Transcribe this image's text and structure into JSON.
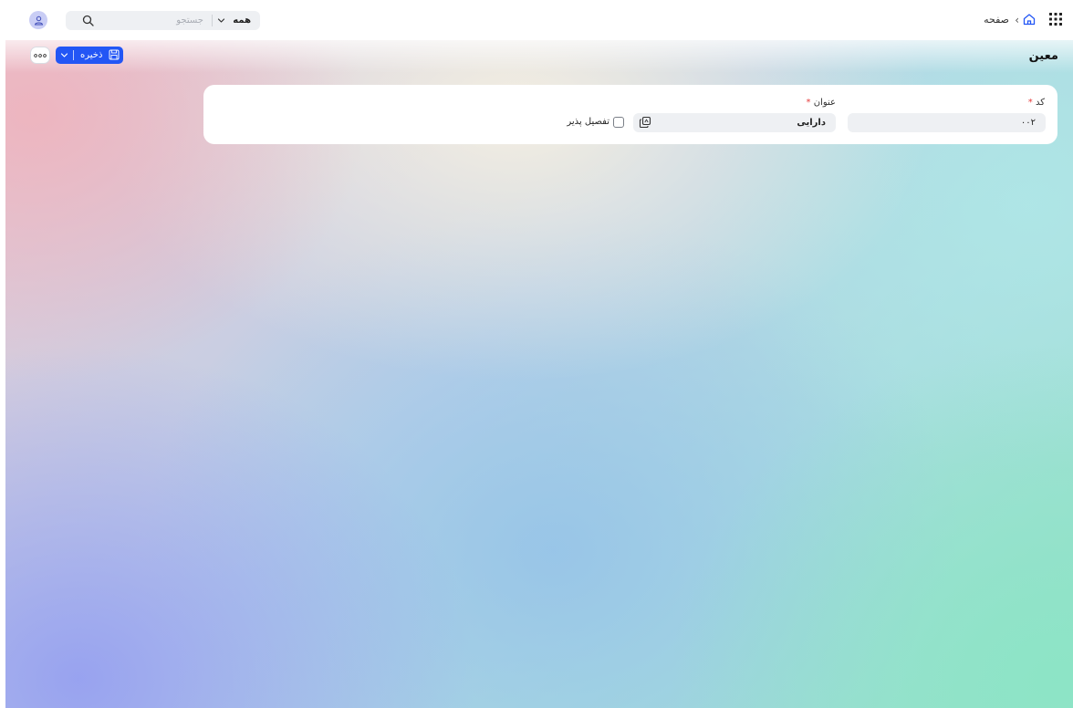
{
  "header": {
    "apps_icon": "grid-icon",
    "home_icon": "home-icon",
    "breadcrumb_separator": "‹",
    "breadcrumb_label": "صفحه",
    "avatar_icon": "user-icon",
    "search": {
      "placeholder": "جستجو",
      "scope_label": "همه",
      "icon": "search-icon"
    }
  },
  "toolbar": {
    "page_title": "معین",
    "save_label": "ذخیره",
    "save_icon": "floppy-disk-icon",
    "more_icon": "ellipsis-icon",
    "accent_color": "#2356f5"
  },
  "form": {
    "code": {
      "label": "کد",
      "required_mark": "*",
      "value": "۰۰۲"
    },
    "title": {
      "label": "عنوان",
      "required_mark": "*",
      "value": "دارایی",
      "lookup_icon": "copy-icon"
    },
    "detailable": {
      "label": "تفصیل پذیر",
      "checked": false
    }
  }
}
